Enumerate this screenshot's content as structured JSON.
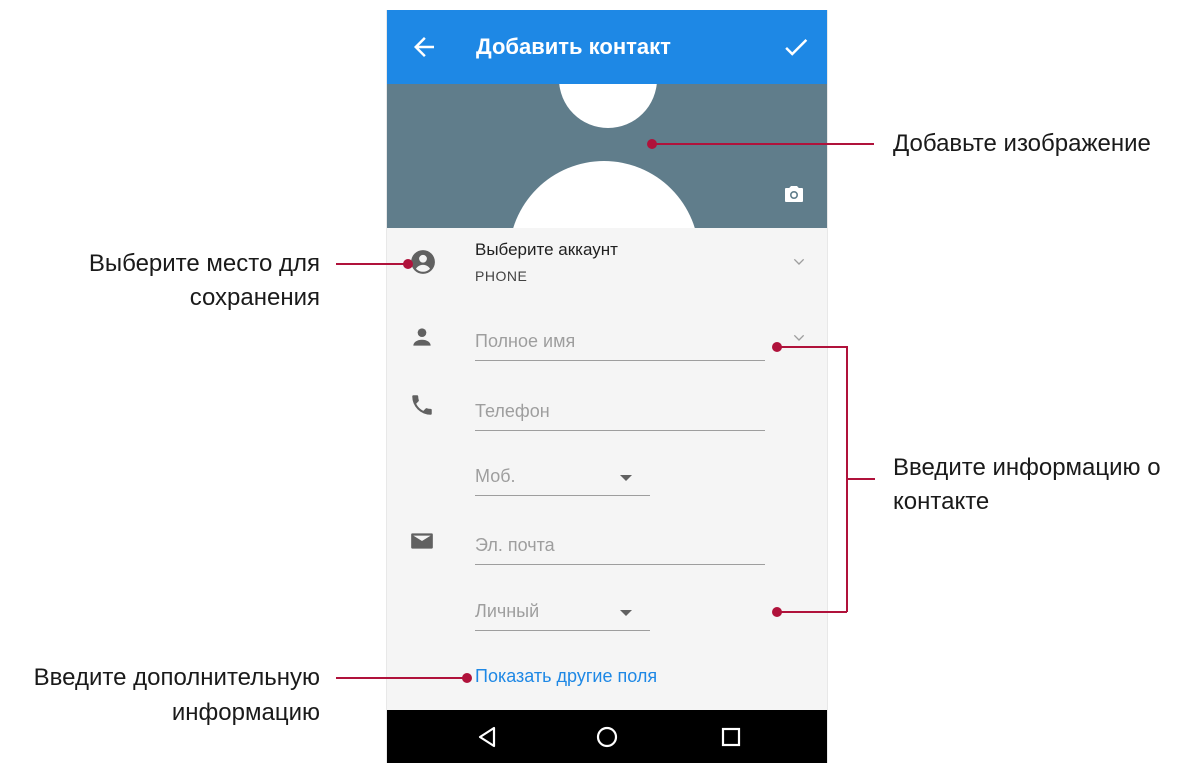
{
  "app_bar": {
    "title": "Добавить контакт",
    "back_icon": "arrow-left-icon",
    "confirm_icon": "checkmark-icon",
    "color": "#1e88e5"
  },
  "photo": {
    "background_color": "#607d8b",
    "camera_icon": "camera-icon"
  },
  "account": {
    "title": "Выберите аккаунт",
    "value": "PHONE"
  },
  "fields": {
    "full_name_placeholder": "Полное имя",
    "phone_placeholder": "Телефон",
    "phone_type": "Моб.",
    "email_placeholder": "Эл. почта",
    "email_type": "Личный"
  },
  "more_fields_link": "Показать другие поля",
  "nav_bar": {
    "back_icon": "triangle-back-icon",
    "home_icon": "circle-home-icon",
    "recents_icon": "square-recents-icon"
  },
  "annotations": {
    "add_image": "Добавьте изображение",
    "choose_storage_line1": "Выберите место для",
    "choose_storage_line2": "сохранения",
    "enter_contact_line1": "Введите информацию о",
    "enter_contact_line2": "контакте",
    "enter_more_line1": "Введите дополнительную",
    "enter_more_line2": "информацию",
    "accent_color": "#b0123b"
  }
}
